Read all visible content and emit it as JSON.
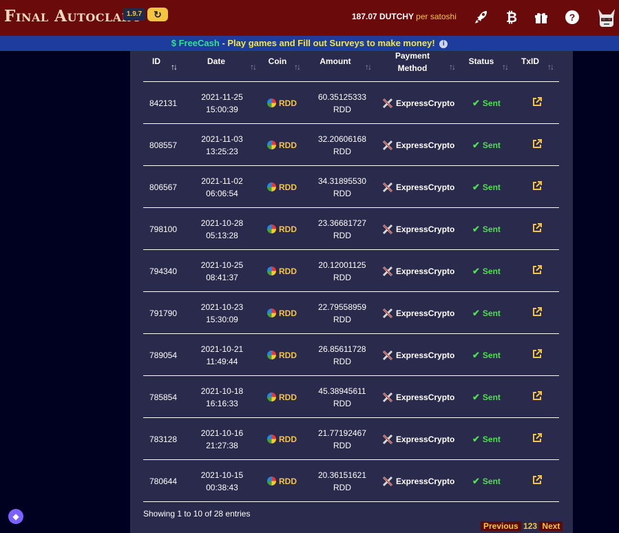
{
  "header": {
    "logo": "Final Autoclaim",
    "version": "1.9.7",
    "refresh_icon": "refresh-icon",
    "price_value": "187.07 DUTCHY",
    "price_unit": "per satoshi",
    "icons": [
      "rocket-icon",
      "bitcoin-icon",
      "gift-icon",
      "help-icon",
      "avatar"
    ]
  },
  "banner": {
    "brand": "FreeCash",
    "text": " - Play games and Fill out Surveys to make money!",
    "info_icon": "info-icon"
  },
  "table": {
    "columns": {
      "id": "ID",
      "date": "Date",
      "coin": "Coin",
      "amount": "Amount",
      "payment_l1": "Payment",
      "payment_l2": "Method",
      "status": "Status",
      "txid": "TxID"
    },
    "rows": [
      {
        "id": "842131",
        "date": "2021-11-25",
        "time": "15:00:39",
        "coin": "RDD",
        "amount": "60.35125333",
        "unit": "RDD",
        "method": "ExpressCrypto",
        "status": "Sent"
      },
      {
        "id": "808557",
        "date": "2021-11-03",
        "time": "13:25:23",
        "coin": "RDD",
        "amount": "32.20606168",
        "unit": "RDD",
        "method": "ExpressCrypto",
        "status": "Sent"
      },
      {
        "id": "806567",
        "date": "2021-11-02",
        "time": "06:06:54",
        "coin": "RDD",
        "amount": "34.31895530",
        "unit": "RDD",
        "method": "ExpressCrypto",
        "status": "Sent"
      },
      {
        "id": "798100",
        "date": "2021-10-28",
        "time": "05:13:28",
        "coin": "RDD",
        "amount": "23.36681727",
        "unit": "RDD",
        "method": "ExpressCrypto",
        "status": "Sent"
      },
      {
        "id": "794340",
        "date": "2021-10-25",
        "time": "08:41:37",
        "coin": "RDD",
        "amount": "20.12001125",
        "unit": "RDD",
        "method": "ExpressCrypto",
        "status": "Sent"
      },
      {
        "id": "791790",
        "date": "2021-10-23",
        "time": "15:30:09",
        "coin": "RDD",
        "amount": "22.79558959",
        "unit": "RDD",
        "method": "ExpressCrypto",
        "status": "Sent"
      },
      {
        "id": "789054",
        "date": "2021-10-21",
        "time": "11:49:44",
        "coin": "RDD",
        "amount": "26.85611728",
        "unit": "RDD",
        "method": "ExpressCrypto",
        "status": "Sent"
      },
      {
        "id": "785854",
        "date": "2021-10-18",
        "time": "16:16:33",
        "coin": "RDD",
        "amount": "45.38945611",
        "unit": "RDD",
        "method": "ExpressCrypto",
        "status": "Sent"
      },
      {
        "id": "783128",
        "date": "2021-10-16",
        "time": "21:27:38",
        "coin": "RDD",
        "amount": "21.77192467",
        "unit": "RDD",
        "method": "ExpressCrypto",
        "status": "Sent"
      },
      {
        "id": "780644",
        "date": "2021-10-15",
        "time": "00:38:43",
        "coin": "RDD",
        "amount": "20.36151621",
        "unit": "RDD",
        "method": "ExpressCrypto",
        "status": "Sent"
      }
    ]
  },
  "footer": {
    "info": "Showing 1 to 10 of 28 entries",
    "prev": "Previous",
    "pages": "123",
    "next": "Next"
  },
  "colors": {
    "header_bg": "#6b0a0a",
    "banner_bg": "#1e3c9e",
    "panel_bg": "#2a2a4d",
    "page_bg": "#000021",
    "accent": "#f5c542",
    "status_sent": "#4ee04e"
  }
}
